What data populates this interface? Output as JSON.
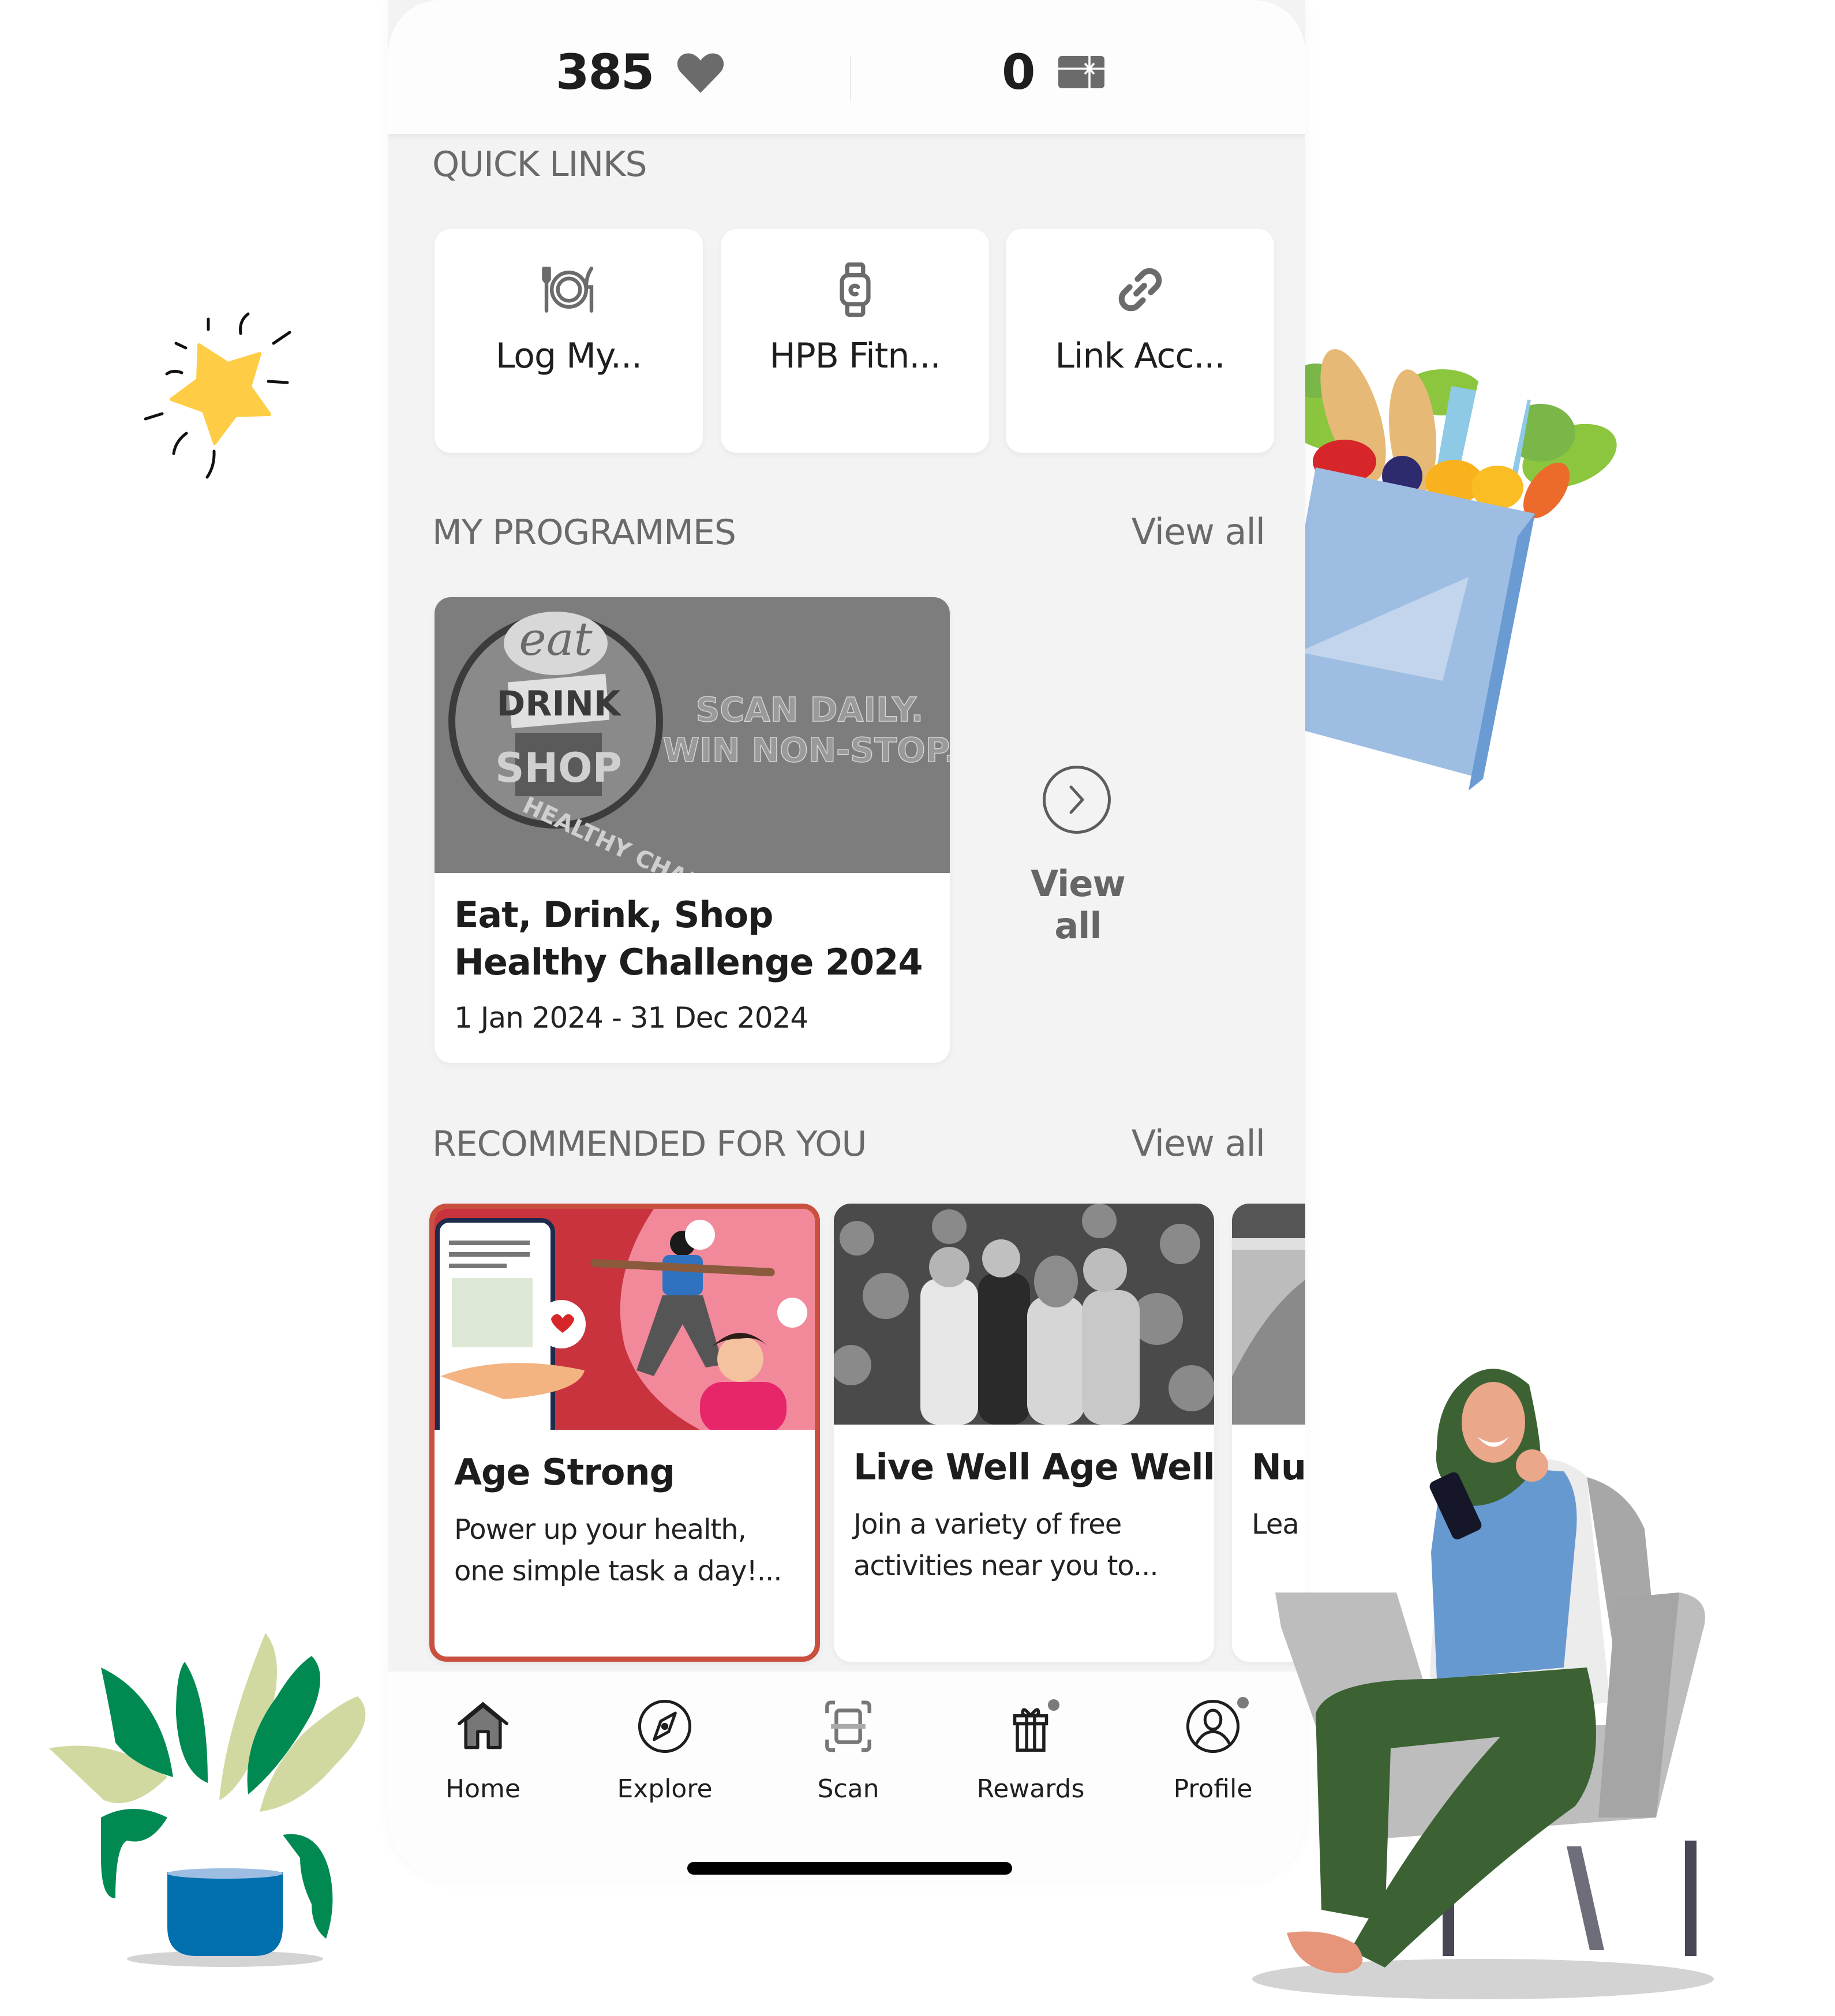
{
  "header": {
    "points_value": "385",
    "points_icon": "heart-icon",
    "vouchers_value": "0",
    "vouchers_icon": "gift-card-icon"
  },
  "quick_links": {
    "title": "QUICK LINKS",
    "items": [
      {
        "label": "Log My...",
        "icon": "plate-cutlery-icon"
      },
      {
        "label": "HPB Fitn...",
        "icon": "smartwatch-icon"
      },
      {
        "label": "Link Acc...",
        "icon": "link-icon"
      }
    ]
  },
  "my_programmes": {
    "title": "MY PROGRAMMES",
    "view_all": "View all",
    "card": {
      "banner_logo_top": "eat",
      "banner_logo_mid": "DRINK",
      "banner_logo_bottom": "SHOP",
      "banner_logo_ring": "HEALTHY CHALLENGE",
      "banner_tagline_1": "SCAN DAILY.",
      "banner_tagline_2": "WIN NON-STOP.",
      "title": "Eat, Drink, Shop Healthy Challenge 2024",
      "date_range": "1 Jan 2024 - 31 Dec 2024"
    },
    "view_all_tile": {
      "label": "View all",
      "icon": "chevron-right-circle-icon"
    }
  },
  "recommended": {
    "title": "RECOMMENDED FOR YOU",
    "view_all": "View all",
    "cards": [
      {
        "title": "Age Strong",
        "description": "Power up your health, one simple task a day!...",
        "selected": true
      },
      {
        "title": "Live Well Age Well",
        "description": "Join a variety of free activities near you to...",
        "selected": false
      },
      {
        "title": "Nut",
        "description": "Lea nutr",
        "selected": false
      }
    ]
  },
  "bottom_nav": {
    "items": [
      {
        "label": "Home",
        "icon": "home-icon",
        "active": true,
        "badge": false
      },
      {
        "label": "Explore",
        "icon": "compass-icon",
        "active": false,
        "badge": false
      },
      {
        "label": "Scan",
        "icon": "scan-icon",
        "active": false,
        "badge": false
      },
      {
        "label": "Rewards",
        "icon": "gift-icon",
        "active": false,
        "badge": true
      },
      {
        "label": "Profile",
        "icon": "profile-icon",
        "active": false,
        "badge": true
      }
    ]
  },
  "colors": {
    "selected_border": "#c9503f",
    "screen_bg": "#f3f3f3",
    "star": "#ffcd45",
    "bag": "#9dbde3",
    "plant_dark": "#008a52",
    "plant_light": "#d1d9a0",
    "pot": "#006fae",
    "hijab": "#3c6234",
    "shirt": "#6699d0"
  }
}
